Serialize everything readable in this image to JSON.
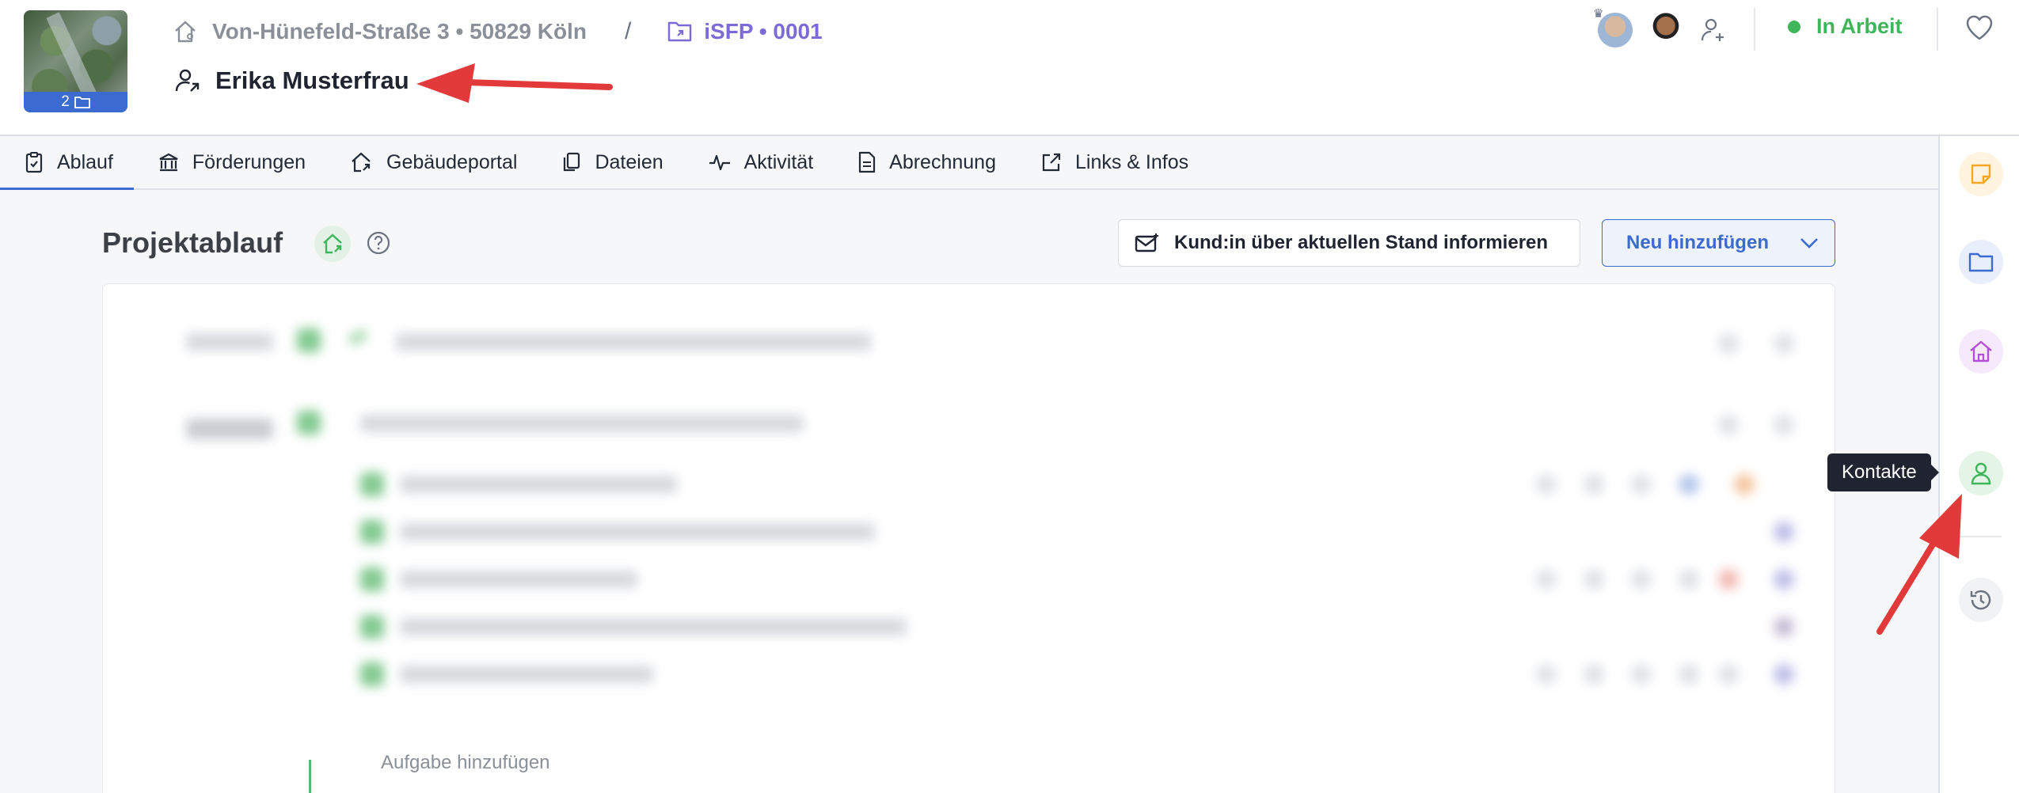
{
  "header": {
    "thumbnail_count": "2",
    "address": "Von-Hünefeld-Straße 3 • 50829 Köln",
    "separator": "/",
    "project": "iSFP • 0001",
    "customer_name": "Erika Musterfrau",
    "status": "In Arbeit",
    "status_color": "#3fb65a",
    "accent_color": "#3b6ad0"
  },
  "tabs": [
    {
      "label": "Ablauf",
      "icon": "clipboard-icon",
      "active": true
    },
    {
      "label": "Förderungen",
      "icon": "bank-icon"
    },
    {
      "label": "Gebäudeportal",
      "icon": "house-share-icon"
    },
    {
      "label": "Dateien",
      "icon": "files-icon"
    },
    {
      "label": "Aktivität",
      "icon": "activity-icon"
    },
    {
      "label": "Abrechnung",
      "icon": "invoice-icon"
    },
    {
      "label": "Links & Infos",
      "icon": "external-link-icon"
    }
  ],
  "main": {
    "title": "Projektablauf",
    "inform_button": "Kund:in über aktuellen Stand informieren",
    "new_button": "Neu hinzufügen",
    "add_task": "Aufgabe hinzufügen"
  },
  "rail": {
    "tooltip": "Kontakte",
    "items": [
      "notes-icon",
      "folder-icon",
      "house-icon",
      "contact-icon",
      "history-icon"
    ]
  }
}
